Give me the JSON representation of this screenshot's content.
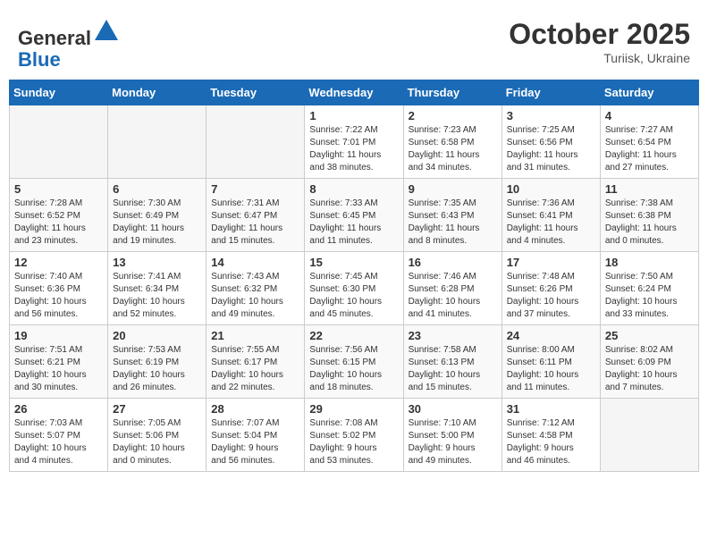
{
  "header": {
    "logo_line1": "General",
    "logo_line2": "Blue",
    "month": "October 2025",
    "location": "Turiisk, Ukraine"
  },
  "weekdays": [
    "Sunday",
    "Monday",
    "Tuesday",
    "Wednesday",
    "Thursday",
    "Friday",
    "Saturday"
  ],
  "weeks": [
    [
      {
        "day": "",
        "info": ""
      },
      {
        "day": "",
        "info": ""
      },
      {
        "day": "",
        "info": ""
      },
      {
        "day": "1",
        "info": "Sunrise: 7:22 AM\nSunset: 7:01 PM\nDaylight: 11 hours\nand 38 minutes."
      },
      {
        "day": "2",
        "info": "Sunrise: 7:23 AM\nSunset: 6:58 PM\nDaylight: 11 hours\nand 34 minutes."
      },
      {
        "day": "3",
        "info": "Sunrise: 7:25 AM\nSunset: 6:56 PM\nDaylight: 11 hours\nand 31 minutes."
      },
      {
        "day": "4",
        "info": "Sunrise: 7:27 AM\nSunset: 6:54 PM\nDaylight: 11 hours\nand 27 minutes."
      }
    ],
    [
      {
        "day": "5",
        "info": "Sunrise: 7:28 AM\nSunset: 6:52 PM\nDaylight: 11 hours\nand 23 minutes."
      },
      {
        "day": "6",
        "info": "Sunrise: 7:30 AM\nSunset: 6:49 PM\nDaylight: 11 hours\nand 19 minutes."
      },
      {
        "day": "7",
        "info": "Sunrise: 7:31 AM\nSunset: 6:47 PM\nDaylight: 11 hours\nand 15 minutes."
      },
      {
        "day": "8",
        "info": "Sunrise: 7:33 AM\nSunset: 6:45 PM\nDaylight: 11 hours\nand 11 minutes."
      },
      {
        "day": "9",
        "info": "Sunrise: 7:35 AM\nSunset: 6:43 PM\nDaylight: 11 hours\nand 8 minutes."
      },
      {
        "day": "10",
        "info": "Sunrise: 7:36 AM\nSunset: 6:41 PM\nDaylight: 11 hours\nand 4 minutes."
      },
      {
        "day": "11",
        "info": "Sunrise: 7:38 AM\nSunset: 6:38 PM\nDaylight: 11 hours\nand 0 minutes."
      }
    ],
    [
      {
        "day": "12",
        "info": "Sunrise: 7:40 AM\nSunset: 6:36 PM\nDaylight: 10 hours\nand 56 minutes."
      },
      {
        "day": "13",
        "info": "Sunrise: 7:41 AM\nSunset: 6:34 PM\nDaylight: 10 hours\nand 52 minutes."
      },
      {
        "day": "14",
        "info": "Sunrise: 7:43 AM\nSunset: 6:32 PM\nDaylight: 10 hours\nand 49 minutes."
      },
      {
        "day": "15",
        "info": "Sunrise: 7:45 AM\nSunset: 6:30 PM\nDaylight: 10 hours\nand 45 minutes."
      },
      {
        "day": "16",
        "info": "Sunrise: 7:46 AM\nSunset: 6:28 PM\nDaylight: 10 hours\nand 41 minutes."
      },
      {
        "day": "17",
        "info": "Sunrise: 7:48 AM\nSunset: 6:26 PM\nDaylight: 10 hours\nand 37 minutes."
      },
      {
        "day": "18",
        "info": "Sunrise: 7:50 AM\nSunset: 6:24 PM\nDaylight: 10 hours\nand 33 minutes."
      }
    ],
    [
      {
        "day": "19",
        "info": "Sunrise: 7:51 AM\nSunset: 6:21 PM\nDaylight: 10 hours\nand 30 minutes."
      },
      {
        "day": "20",
        "info": "Sunrise: 7:53 AM\nSunset: 6:19 PM\nDaylight: 10 hours\nand 26 minutes."
      },
      {
        "day": "21",
        "info": "Sunrise: 7:55 AM\nSunset: 6:17 PM\nDaylight: 10 hours\nand 22 minutes."
      },
      {
        "day": "22",
        "info": "Sunrise: 7:56 AM\nSunset: 6:15 PM\nDaylight: 10 hours\nand 18 minutes."
      },
      {
        "day": "23",
        "info": "Sunrise: 7:58 AM\nSunset: 6:13 PM\nDaylight: 10 hours\nand 15 minutes."
      },
      {
        "day": "24",
        "info": "Sunrise: 8:00 AM\nSunset: 6:11 PM\nDaylight: 10 hours\nand 11 minutes."
      },
      {
        "day": "25",
        "info": "Sunrise: 8:02 AM\nSunset: 6:09 PM\nDaylight: 10 hours\nand 7 minutes."
      }
    ],
    [
      {
        "day": "26",
        "info": "Sunrise: 7:03 AM\nSunset: 5:07 PM\nDaylight: 10 hours\nand 4 minutes."
      },
      {
        "day": "27",
        "info": "Sunrise: 7:05 AM\nSunset: 5:06 PM\nDaylight: 10 hours\nand 0 minutes."
      },
      {
        "day": "28",
        "info": "Sunrise: 7:07 AM\nSunset: 5:04 PM\nDaylight: 9 hours\nand 56 minutes."
      },
      {
        "day": "29",
        "info": "Sunrise: 7:08 AM\nSunset: 5:02 PM\nDaylight: 9 hours\nand 53 minutes."
      },
      {
        "day": "30",
        "info": "Sunrise: 7:10 AM\nSunset: 5:00 PM\nDaylight: 9 hours\nand 49 minutes."
      },
      {
        "day": "31",
        "info": "Sunrise: 7:12 AM\nSunset: 4:58 PM\nDaylight: 9 hours\nand 46 minutes."
      },
      {
        "day": "",
        "info": ""
      }
    ]
  ]
}
